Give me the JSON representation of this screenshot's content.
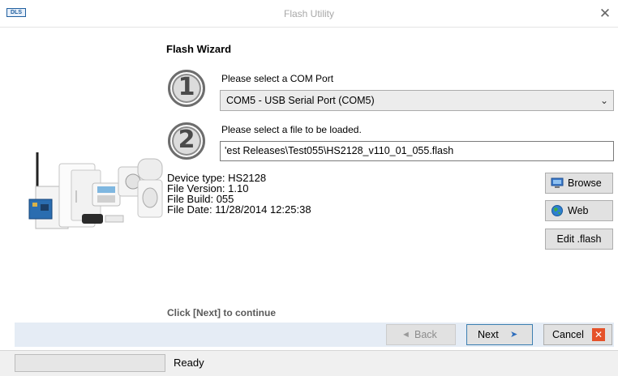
{
  "window": {
    "title": "Flash Utility",
    "app_icon_text": "DLS",
    "close_glyph": "✕"
  },
  "wizard": {
    "title": "Flash Wizard",
    "step1": {
      "number": "1",
      "label": "Please select a COM Port"
    },
    "step2": {
      "number": "2",
      "label": "Please select a file to be loaded."
    },
    "com_port": {
      "selected": "COM5 - USB Serial Port (COM5)"
    },
    "file_path": {
      "value": "'est Releases\\Test055\\HS2128_v110_01_055.flash"
    }
  },
  "device_info": {
    "device_type": "Device type: HS2128",
    "file_version": "File Version: 1.10",
    "file_build": "File Build: 055",
    "file_date": "File Date: 11/28/2014 12:25:38"
  },
  "side_buttons": {
    "browse": "Browse",
    "web": "Web",
    "edit": "Edit .flash"
  },
  "hint": "Click [Next] to continue",
  "nav": {
    "back": "Back",
    "next": "Next",
    "cancel": "Cancel"
  },
  "status": {
    "text": "Ready",
    "progress_percent": 0
  },
  "icons": {
    "browse": "computer-icon",
    "web": "globe-icon",
    "back": "arrow-left-icon",
    "next": "arrow-right-icon",
    "cancel": "red-x-icon"
  },
  "colors": {
    "button_bar": "#e5ecf5",
    "next_border": "#3c7fb1",
    "cancel_x": "#e5522a"
  }
}
